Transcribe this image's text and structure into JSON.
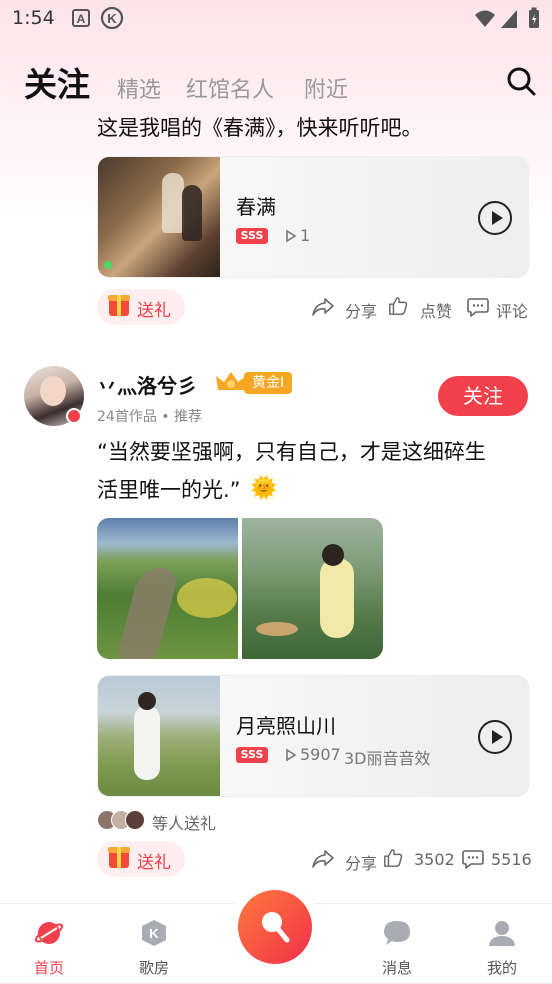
{
  "status_bar": {
    "time": "1:54",
    "icons": [
      "a-box-icon",
      "k-circle-icon",
      "wifi-icon",
      "signal-icon",
      "battery-charging-icon"
    ]
  },
  "header": {
    "tabs": [
      {
        "label": "关注",
        "active": true
      },
      {
        "label": "精选"
      },
      {
        "label": "红馆名人"
      },
      {
        "label": "附近"
      }
    ],
    "search_icon": "search-icon"
  },
  "posts": [
    {
      "text": "这是我唱的《春满》，快来听听吧。",
      "song": {
        "title": "春满",
        "badge": "SSS",
        "plays": "1"
      },
      "actions": {
        "gift": "送礼",
        "share": "分享",
        "like": "点赞",
        "comment": "评论"
      }
    },
    {
      "user": {
        "name": "丷灬洛兮彡",
        "level": "黄金I",
        "sub": "24首作品 • 推荐",
        "follow": "关注"
      },
      "text_line1": "“当然要坚强啊，只有自己，才是这细碎生",
      "text_line2": "活里唯一的光.”",
      "emoji": "🌞",
      "song": {
        "title": "月亮照山川",
        "badge": "SSS",
        "plays": "5907",
        "effect": "3D丽音音效"
      },
      "gifted_by": "等人送礼",
      "actions": {
        "gift": "送礼",
        "share": "分享",
        "likes": "3502",
        "comments": "5516"
      }
    }
  ],
  "bottom_nav": [
    {
      "label": "首页",
      "icon": "planet-icon",
      "active": true
    },
    {
      "label": "歌房",
      "icon": "k-room-icon"
    },
    {
      "label": "",
      "icon": "microphone-icon"
    },
    {
      "label": "消息",
      "icon": "message-icon"
    },
    {
      "label": "我的",
      "icon": "user-icon"
    }
  ],
  "colors": {
    "accent": "#f0424d",
    "gold": "#f5a623"
  }
}
